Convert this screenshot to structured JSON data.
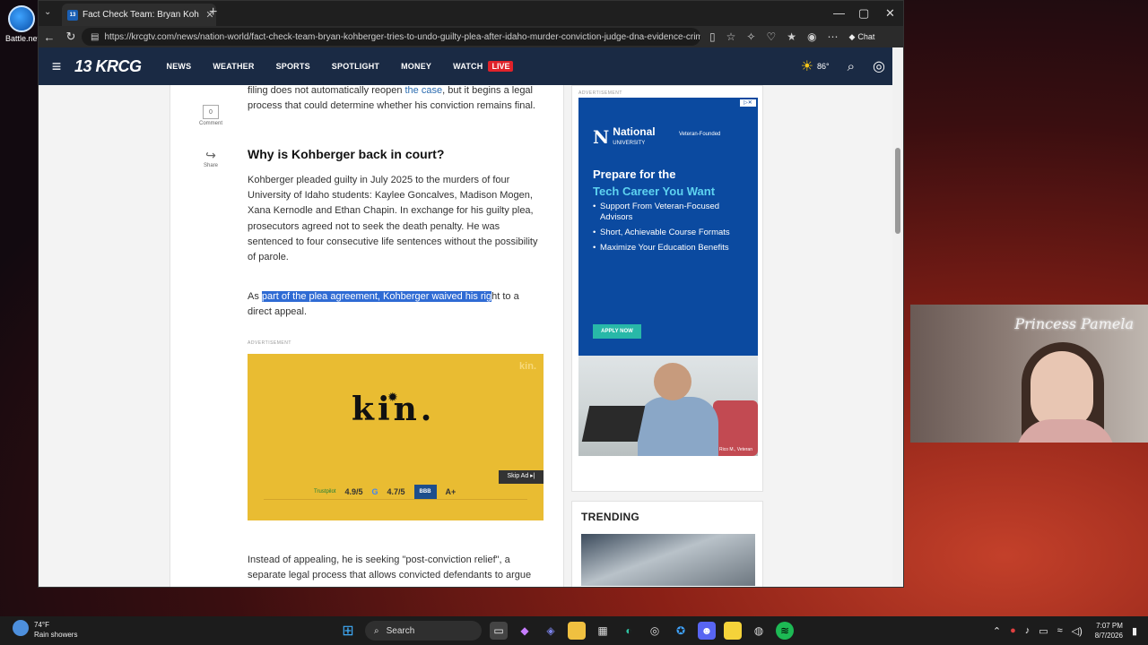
{
  "desktop": {
    "icon_label": "Battle.net"
  },
  "browser": {
    "tab_title": "Fact Check Team: Bryan Kohberger",
    "url": "https://krcgtv.com/news/nation-world/fact-check-team-bryan-kohberger-tries-to-undo-guilty-plea-after-idaho-murder-conviction-judge-dna-evidence-crime-...",
    "chat_label": "Chat"
  },
  "site": {
    "logo": "13 KRCG",
    "nav": [
      "NEWS",
      "WEATHER",
      "SPORTS",
      "SPOTLIGHT",
      "MONEY",
      "WATCH"
    ],
    "live_label": "LIVE",
    "temperature": "86°"
  },
  "article": {
    "comment_count": "0",
    "comment_label": "Comment",
    "share_label": "Share",
    "p1_before": "filing does not automatically reopen ",
    "p1_link": "the case",
    "p1_after": ", but it begins a legal process that could determine whether his conviction remains final.",
    "subhead": "Why is Kohberger back in court?",
    "p2": "Kohberger pleaded guilty in July 2025 to the murders of four University of Idaho students: Kaylee Goncalves, Madison Mogen, Xana Kernodle and Ethan Chapin. In exchange for his guilty plea, prosecutors agreed not to seek the death penalty. He was sentenced to four consecutive life sentences without the possibility of parole.",
    "p3_before": "As ",
    "p3_highlight": "part of the plea agreement, Kohberger waived his rig",
    "p3_after": "ht to a direct appeal.",
    "ad_label": "ADVERTISEMENT",
    "p4": "Instead of appealing, he is seeking \"post-conviction relief\", a separate legal process that allows convicted defendants to argue"
  },
  "kin_ad": {
    "word": "kin.",
    "corner": "kin.",
    "skip_label": "Skip Ad ▸|",
    "trustpilot_label": "Trustpilot",
    "trustpilot_score": "4.9/5",
    "google_score": "4.7/5",
    "bbb_score": "A+"
  },
  "sidebar": {
    "ad_label": "ADVERTISEMENT",
    "brand": "National",
    "brand_sub": "UNIVERSITY",
    "tagline": "Veteran-Founded",
    "headline_1": "Prepare for the",
    "headline_2": "Tech Career You Want",
    "bullets": [
      "Support From Veteran-Focused Advisors",
      "Short, Achievable Course Formats",
      "Maximize Your Education Benefits"
    ],
    "apply_label": "APPLY NOW",
    "photo_caption": "Rico M., Veteran",
    "trending_title": "TRENDING"
  },
  "webcam": {
    "overlay_text": "Princess Pamela"
  },
  "taskbar": {
    "weather_temp": "74°F",
    "weather_desc": "Rain showers",
    "search_placeholder": "Search",
    "time": "7:07 PM",
    "date": "8/7/2026"
  }
}
